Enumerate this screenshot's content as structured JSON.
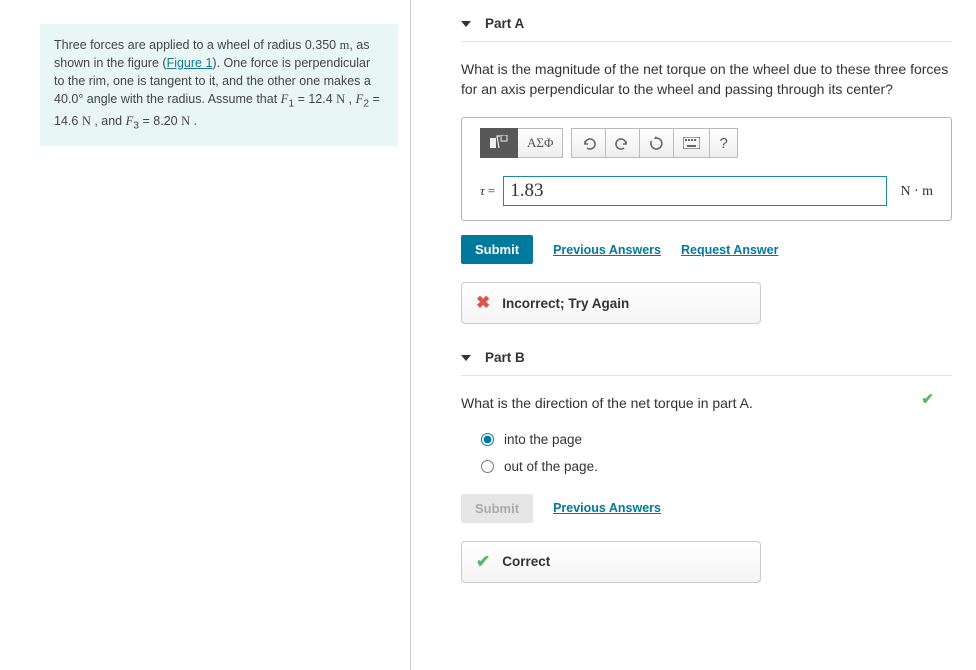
{
  "problem": {
    "text_pre": "Three forces are applied to a wheel of radius 0.350 ",
    "unit_m": "m",
    "text_mid1": ", as shown in the figure (",
    "figure_label": "Figure 1",
    "text_mid2": "). One force is perpendicular to the rim, one is tangent to it, and the other one makes a 40.0° angle with the radius. Assume that ",
    "f1sym": "F",
    "f1sub": "1",
    "eq": " = ",
    "f1v": "12.4 ",
    "n": "N",
    "f2sym": "F",
    "f2sub": "2",
    "f2v": "14.6 ",
    "f3sym": "F",
    "f3sub": "3",
    "f3v": "8.20 ",
    "and": " , and ",
    "comma": " , ",
    "dot": " ."
  },
  "partA": {
    "title": "Part A",
    "question": "What is the magnitude of the net torque on the wheel due to these three forces for an axis perpendicular to the wheel and passing through its center?",
    "toolbar": {
      "greek_label": "ΑΣΦ",
      "help": "?"
    },
    "answer_prefix_sym": "τ",
    "answer_prefix_eq": " = ",
    "answer_value": "1.83",
    "answer_unit": "N ⋅ m",
    "submit": "Submit",
    "previous": "Previous Answers",
    "request": "Request Answer",
    "feedback": "Incorrect; Try Again"
  },
  "partB": {
    "title": "Part B",
    "question": "What is the direction of the net torque in part A.",
    "opt1": "into the page",
    "opt2": "out of the page.",
    "submit": "Submit",
    "previous": "Previous Answers",
    "feedback": "Correct"
  }
}
